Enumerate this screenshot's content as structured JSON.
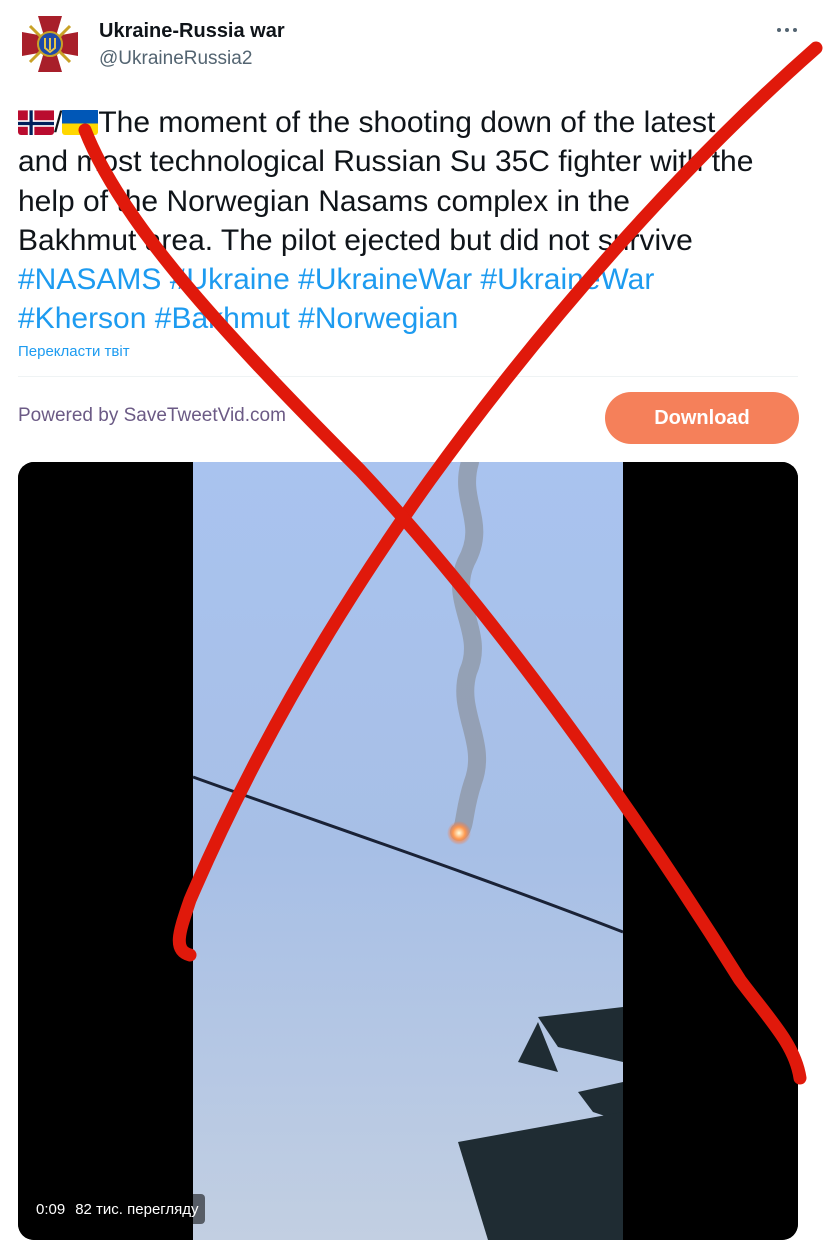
{
  "author": {
    "name": "Ukraine-Russia war",
    "handle": "@UkraineRussia2",
    "avatar_icon": "military-emblem-icon"
  },
  "more_icon": "more-options-icon",
  "tweet": {
    "flags": [
      "norway-flag-icon",
      "ukraine-flag-icon"
    ],
    "separator": "/",
    "lines": [
      "The moment of the shooting down of the latest",
      "and most technological Russian Su 35C fighter with the",
      "help of the Norwegian Nasams complex in the",
      "Bakhmut area. The pilot ejected but did not survive"
    ],
    "hashtags": [
      "#NASAMS",
      "#Ukraine",
      "#UkraineWar",
      "#UkraineWar",
      "#Kherson",
      "#Bakhmut",
      "#Norwegian"
    ],
    "translate_link": "Перекласти твіт"
  },
  "promo": {
    "powered_by": "Powered by SaveTweetVid.com",
    "download_label": "Download"
  },
  "video": {
    "duration": "0:09",
    "views": "82 тис. перегляду"
  },
  "colors": {
    "link": "#1d9bf0",
    "download_button": "#f5805a",
    "overlay_cross": "#e0190b"
  }
}
